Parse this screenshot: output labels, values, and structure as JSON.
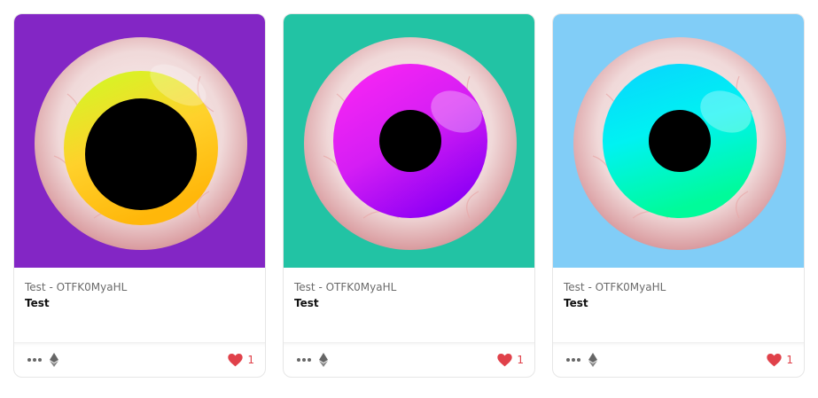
{
  "cards": [
    {
      "collection": "Test - OTFK0MyaHL",
      "title": "Test",
      "likes": "1",
      "background": "#8326c5",
      "iris_stops": [
        "#cdfd24",
        "#ffd12b",
        "#ffb70a"
      ],
      "pupil_ratio": 0.72,
      "icons": [
        "more-icon",
        "ethereum-icon",
        "heart-icon"
      ]
    },
    {
      "collection": "Test - OTFK0MyaHL",
      "title": "Test",
      "likes": "1",
      "background": "#22c3a4",
      "iris_stops": [
        "#ff26f4",
        "#d51ef4",
        "#9000f5"
      ],
      "pupil_ratio": 0.4,
      "icons": [
        "more-icon",
        "ethereum-icon",
        "heart-icon"
      ]
    },
    {
      "collection": "Test - OTFK0MyaHL",
      "title": "Test",
      "likes": "1",
      "background": "#81cdf7",
      "iris_stops": [
        "#09d3ff",
        "#00f2f2",
        "#00fb9a"
      ],
      "pupil_ratio": 0.4,
      "icons": [
        "more-icon",
        "ethereum-icon",
        "heart-icon"
      ]
    }
  ],
  "colors": {
    "heart": "#e0414a",
    "muted": "#6b6b6b",
    "sclera": "#f3e2e2",
    "vein": "#e8a6a6"
  }
}
